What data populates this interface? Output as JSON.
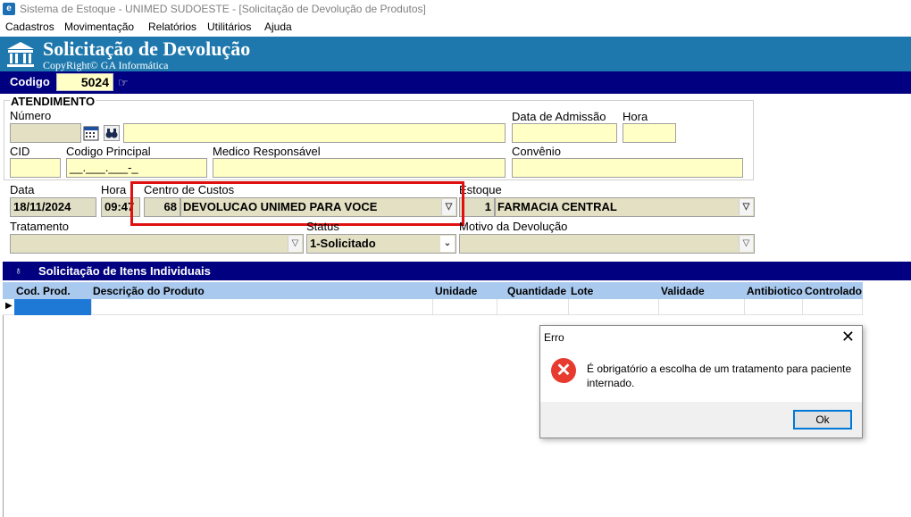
{
  "window": {
    "title": "Sistema de Estoque - UNIMED SUDOESTE - [Solicitação de Devolução de Produtos]",
    "app_icon": "e"
  },
  "menu": [
    "Cadastros",
    "Movimentação",
    "Relatórios",
    "Utilitários",
    "Ajuda"
  ],
  "header": {
    "title": "Solicitação de Devolução",
    "subtitle": "CopyRight© GA Informática",
    "brand_color": "#1e78ad"
  },
  "codebar": {
    "label": "Codigo",
    "value": "5024"
  },
  "atendimento": {
    "group_label": "ATENDIMENTO",
    "numero_label": "Número",
    "numero_value": "",
    "data_admissao_label": "Data de Admissão",
    "data_admissao_value": "",
    "hora_label": "Hora",
    "hora_value": "",
    "cid_label": "CID",
    "cid_value": "",
    "codigo_principal_label": "Codigo Principal",
    "codigo_principal_value": "__.___.___-_",
    "medico_label": "Medico Responsável",
    "medico_value": "",
    "convenio_label": "Convênio",
    "convenio_value": ""
  },
  "form": {
    "data_label": "Data",
    "data_value": "18/11/2024",
    "hora_label": "Hora",
    "hora_value": "09:47",
    "centro_label": "Centro de Custos",
    "centro_code": "68",
    "centro_value": "DEVOLUCAO UNIMED PARA VOCE",
    "estoque_label": "Estoque",
    "estoque_code": "1",
    "estoque_value": "FARMACIA CENTRAL",
    "tratamento_label": "Tratamento",
    "tratamento_value": "",
    "status_label": "Status",
    "status_value": "1-Solicitado",
    "motivo_label": "Motivo da Devolução",
    "motivo_value": ""
  },
  "items": {
    "title": "Solicitação de Itens Individuais",
    "columns": [
      "Cod. Prod.",
      "Descrição do Produto",
      "Unidade",
      "Quantidade",
      "Lote",
      "Validade",
      "Antibiotico",
      "Controlado"
    ]
  },
  "dialog": {
    "title": "Erro",
    "close": "✕",
    "icon": "error-icon",
    "message": "É obrigatório a escolha de um tratamento para paciente internado.",
    "ok_label": "Ok"
  }
}
